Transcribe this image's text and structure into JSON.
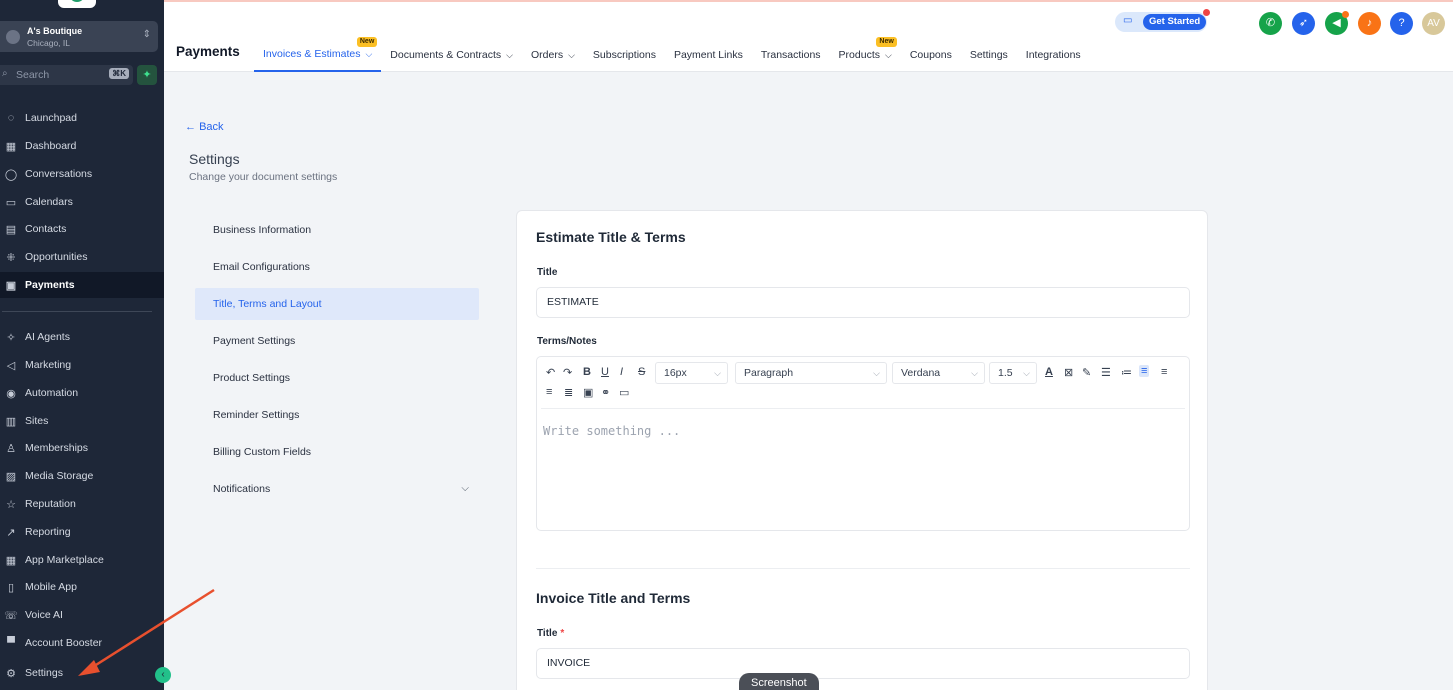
{
  "sidebar": {
    "location": {
      "name": "A's Boutique",
      "city": "Chicago, IL"
    },
    "search": {
      "placeholder": "Search",
      "shortcut": "⌘K"
    },
    "items": [
      {
        "label": "Launchpad",
        "icon": "rocket-icon",
        "glyph": "◌"
      },
      {
        "label": "Dashboard",
        "icon": "grid-icon",
        "glyph": "▦"
      },
      {
        "label": "Conversations",
        "icon": "chat-icon",
        "glyph": "◯"
      },
      {
        "label": "Calendars",
        "icon": "calendar-icon",
        "glyph": "▭"
      },
      {
        "label": "Contacts",
        "icon": "contacts-icon",
        "glyph": "▤"
      },
      {
        "label": "Opportunities",
        "icon": "funnel-icon",
        "glyph": "⁜"
      },
      {
        "label": "Payments",
        "icon": "receipt-icon",
        "glyph": "▣",
        "active": true
      },
      {
        "label": "AI Agents",
        "icon": "sparkle-icon",
        "glyph": "✧"
      },
      {
        "label": "Marketing",
        "icon": "send-icon",
        "glyph": "◁"
      },
      {
        "label": "Automation",
        "icon": "automation-icon",
        "glyph": "◉"
      },
      {
        "label": "Sites",
        "icon": "sites-icon",
        "glyph": "▥"
      },
      {
        "label": "Memberships",
        "icon": "membership-icon",
        "glyph": "♙"
      },
      {
        "label": "Media Storage",
        "icon": "image-icon",
        "glyph": "▨"
      },
      {
        "label": "Reputation",
        "icon": "star-icon",
        "glyph": "☆"
      },
      {
        "label": "Reporting",
        "icon": "chart-icon",
        "glyph": "↗"
      },
      {
        "label": "App Marketplace",
        "icon": "apps-icon",
        "glyph": "▦"
      },
      {
        "label": "Mobile App",
        "icon": "mobile-icon",
        "glyph": "▯"
      },
      {
        "label": "Voice AI",
        "icon": "voice-icon",
        "glyph": "☏"
      },
      {
        "label": "Account Booster",
        "icon": "booster-icon",
        "glyph": "▀"
      },
      {
        "label": "Settings",
        "icon": "gear-icon",
        "glyph": "⚙"
      }
    ]
  },
  "topbar": {
    "get_started": "Get Started",
    "avatar": "AV",
    "colors": {
      "phone": "#16a34a",
      "rocket": "#2563eb",
      "megaphone": "#16a34a",
      "bell": "#f97316",
      "help": "#2563eb",
      "avatar": "#d8c89a"
    }
  },
  "header": {
    "title": "Payments",
    "tabs": [
      {
        "label": "Invoices & Estimates",
        "caret": true,
        "badge": "New",
        "active": true
      },
      {
        "label": "Documents & Contracts",
        "caret": true
      },
      {
        "label": "Orders",
        "caret": true
      },
      {
        "label": "Subscriptions"
      },
      {
        "label": "Payment Links"
      },
      {
        "label": "Transactions"
      },
      {
        "label": "Products",
        "caret": true,
        "badge": "New"
      },
      {
        "label": "Coupons"
      },
      {
        "label": "Settings"
      },
      {
        "label": "Integrations"
      }
    ]
  },
  "main": {
    "back": "Back",
    "title": "Settings",
    "subtitle": "Change your document settings",
    "subnav": [
      {
        "label": "Business Information"
      },
      {
        "label": "Email Configurations"
      },
      {
        "label": "Title, Terms and Layout",
        "active": true
      },
      {
        "label": "Payment Settings"
      },
      {
        "label": "Product Settings"
      },
      {
        "label": "Reminder Settings"
      },
      {
        "label": "Billing Custom Fields"
      },
      {
        "label": "Notifications",
        "expandable": true
      }
    ]
  },
  "card": {
    "estimate_heading": "Estimate Title & Terms",
    "title_label": "Title",
    "estimate_title_value": "ESTIMATE",
    "terms_label": "Terms/Notes",
    "editor": {
      "font_size": "16px",
      "block_format": "Paragraph",
      "font_family": "Verdana",
      "line_height": "1.5",
      "placeholder": "Write something ..."
    },
    "invoice_heading": "Invoice Title and Terms",
    "invoice_title_label": "Title",
    "invoice_required_mark": "*",
    "invoice_title_value": "INVOICE"
  },
  "overlay": {
    "tooltip": "Screenshot"
  }
}
